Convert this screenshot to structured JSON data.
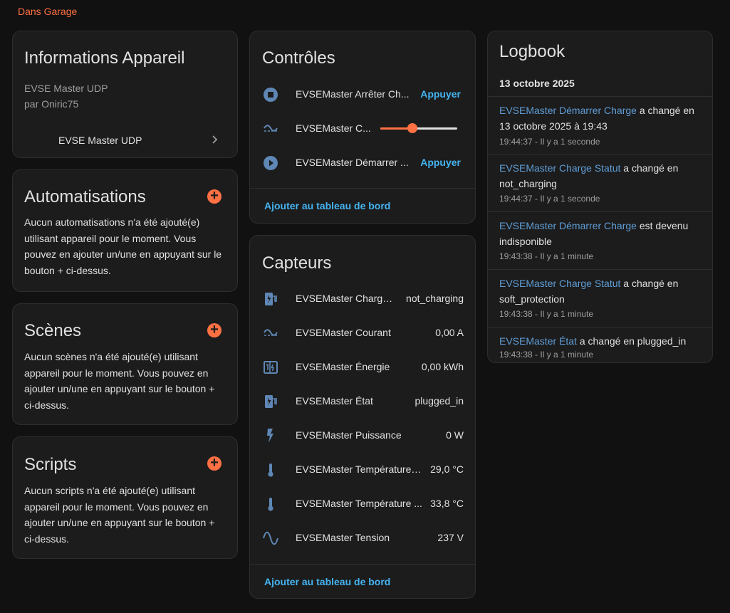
{
  "area": "Dans Garage",
  "device_info": {
    "title": "Informations Appareil",
    "model": "EVSE Master UDP",
    "manufacturer": "par Oniric75",
    "link_label": "EVSE Master UDP"
  },
  "automations": {
    "title": "Automatisations",
    "text": "Aucun automatisations n'a été ajouté(e) utilisant appareil pour le moment. Vous pouvez en ajouter un/une en appuyant sur le bouton + ci-dessus."
  },
  "scenes": {
    "title": "Scènes",
    "text": "Aucun scènes n'a été ajouté(e) utilisant appareil pour le moment. Vous pouvez en ajouter un/une en appuyant sur le bouton + ci-dessus."
  },
  "scripts": {
    "title": "Scripts",
    "text": "Aucun scripts n'a été ajouté(e) utilisant appareil pour le moment. Vous pouvez en ajouter un/une en appuyant sur le bouton + ci-dessus."
  },
  "controls": {
    "title": "Contrôles",
    "items": [
      {
        "name": "EVSEMaster Arrêter Ch...",
        "action": "Appuyer",
        "icon": "stop-circle-icon"
      },
      {
        "name": "EVSEMaster C...",
        "slider_fraction": 0.42,
        "icon": "current-ac-icon"
      },
      {
        "name": "EVSEMaster Démarrer ...",
        "action": "Appuyer",
        "icon": "play-circle-icon"
      }
    ],
    "add_label": "Ajouter au tableau de bord"
  },
  "sensors": {
    "title": "Capteurs",
    "items": [
      {
        "name": "EVSEMaster Charge ...",
        "value": "not_charging",
        "icon": "ev-station-icon"
      },
      {
        "name": "EVSEMaster Courant",
        "value": "0,00 A",
        "icon": "current-ac-icon"
      },
      {
        "name": "EVSEMaster Énergie",
        "value": "0,00 kWh",
        "icon": "meter-icon"
      },
      {
        "name": "EVSEMaster État",
        "value": "plugged_in",
        "icon": "ev-station-icon"
      },
      {
        "name": "EVSEMaster Puissance",
        "value": "0 W",
        "icon": "flash-icon"
      },
      {
        "name": "EVSEMaster Température I...",
        "value": "29,0 °C",
        "icon": "thermometer-icon"
      },
      {
        "name": "EVSEMaster Température ...",
        "value": "33,8 °C",
        "icon": "thermometer-icon"
      },
      {
        "name": "EVSEMaster Tension",
        "value": "237 V",
        "icon": "sine-wave-icon"
      }
    ],
    "add_label": "Ajouter au tableau de bord"
  },
  "logbook": {
    "title": "Logbook",
    "date": "13 octobre 2025",
    "entries": [
      {
        "entity": "EVSEMaster Démarrer Charge",
        "text": " a changé en 13 octobre 2025 à 19:43",
        "time": "19:44:37 - Il y a 1 seconde"
      },
      {
        "entity": "EVSEMaster Charge Statut",
        "text": " a changé en not_charging",
        "time": "19:44:37 - Il y a 1 seconde"
      },
      {
        "entity": "EVSEMaster Démarrer Charge",
        "text": " est devenu indisponible",
        "time": "19:43:38 - Il y a 1 minute"
      },
      {
        "entity": "EVSEMaster Charge Statut",
        "text": " a changé en soft_protection",
        "time": "19:43:38 - Il y a 1 minute"
      },
      {
        "entity": "EVSEMaster État",
        "text": " a changé en plugged_in",
        "time": "19:43:38 - Il y a 1 minute"
      }
    ]
  },
  "colors": {
    "accent": "#ff7043",
    "link": "#44b4f2",
    "icon": "#5f87b5",
    "background": "#111111",
    "card": "#1c1c1c"
  }
}
